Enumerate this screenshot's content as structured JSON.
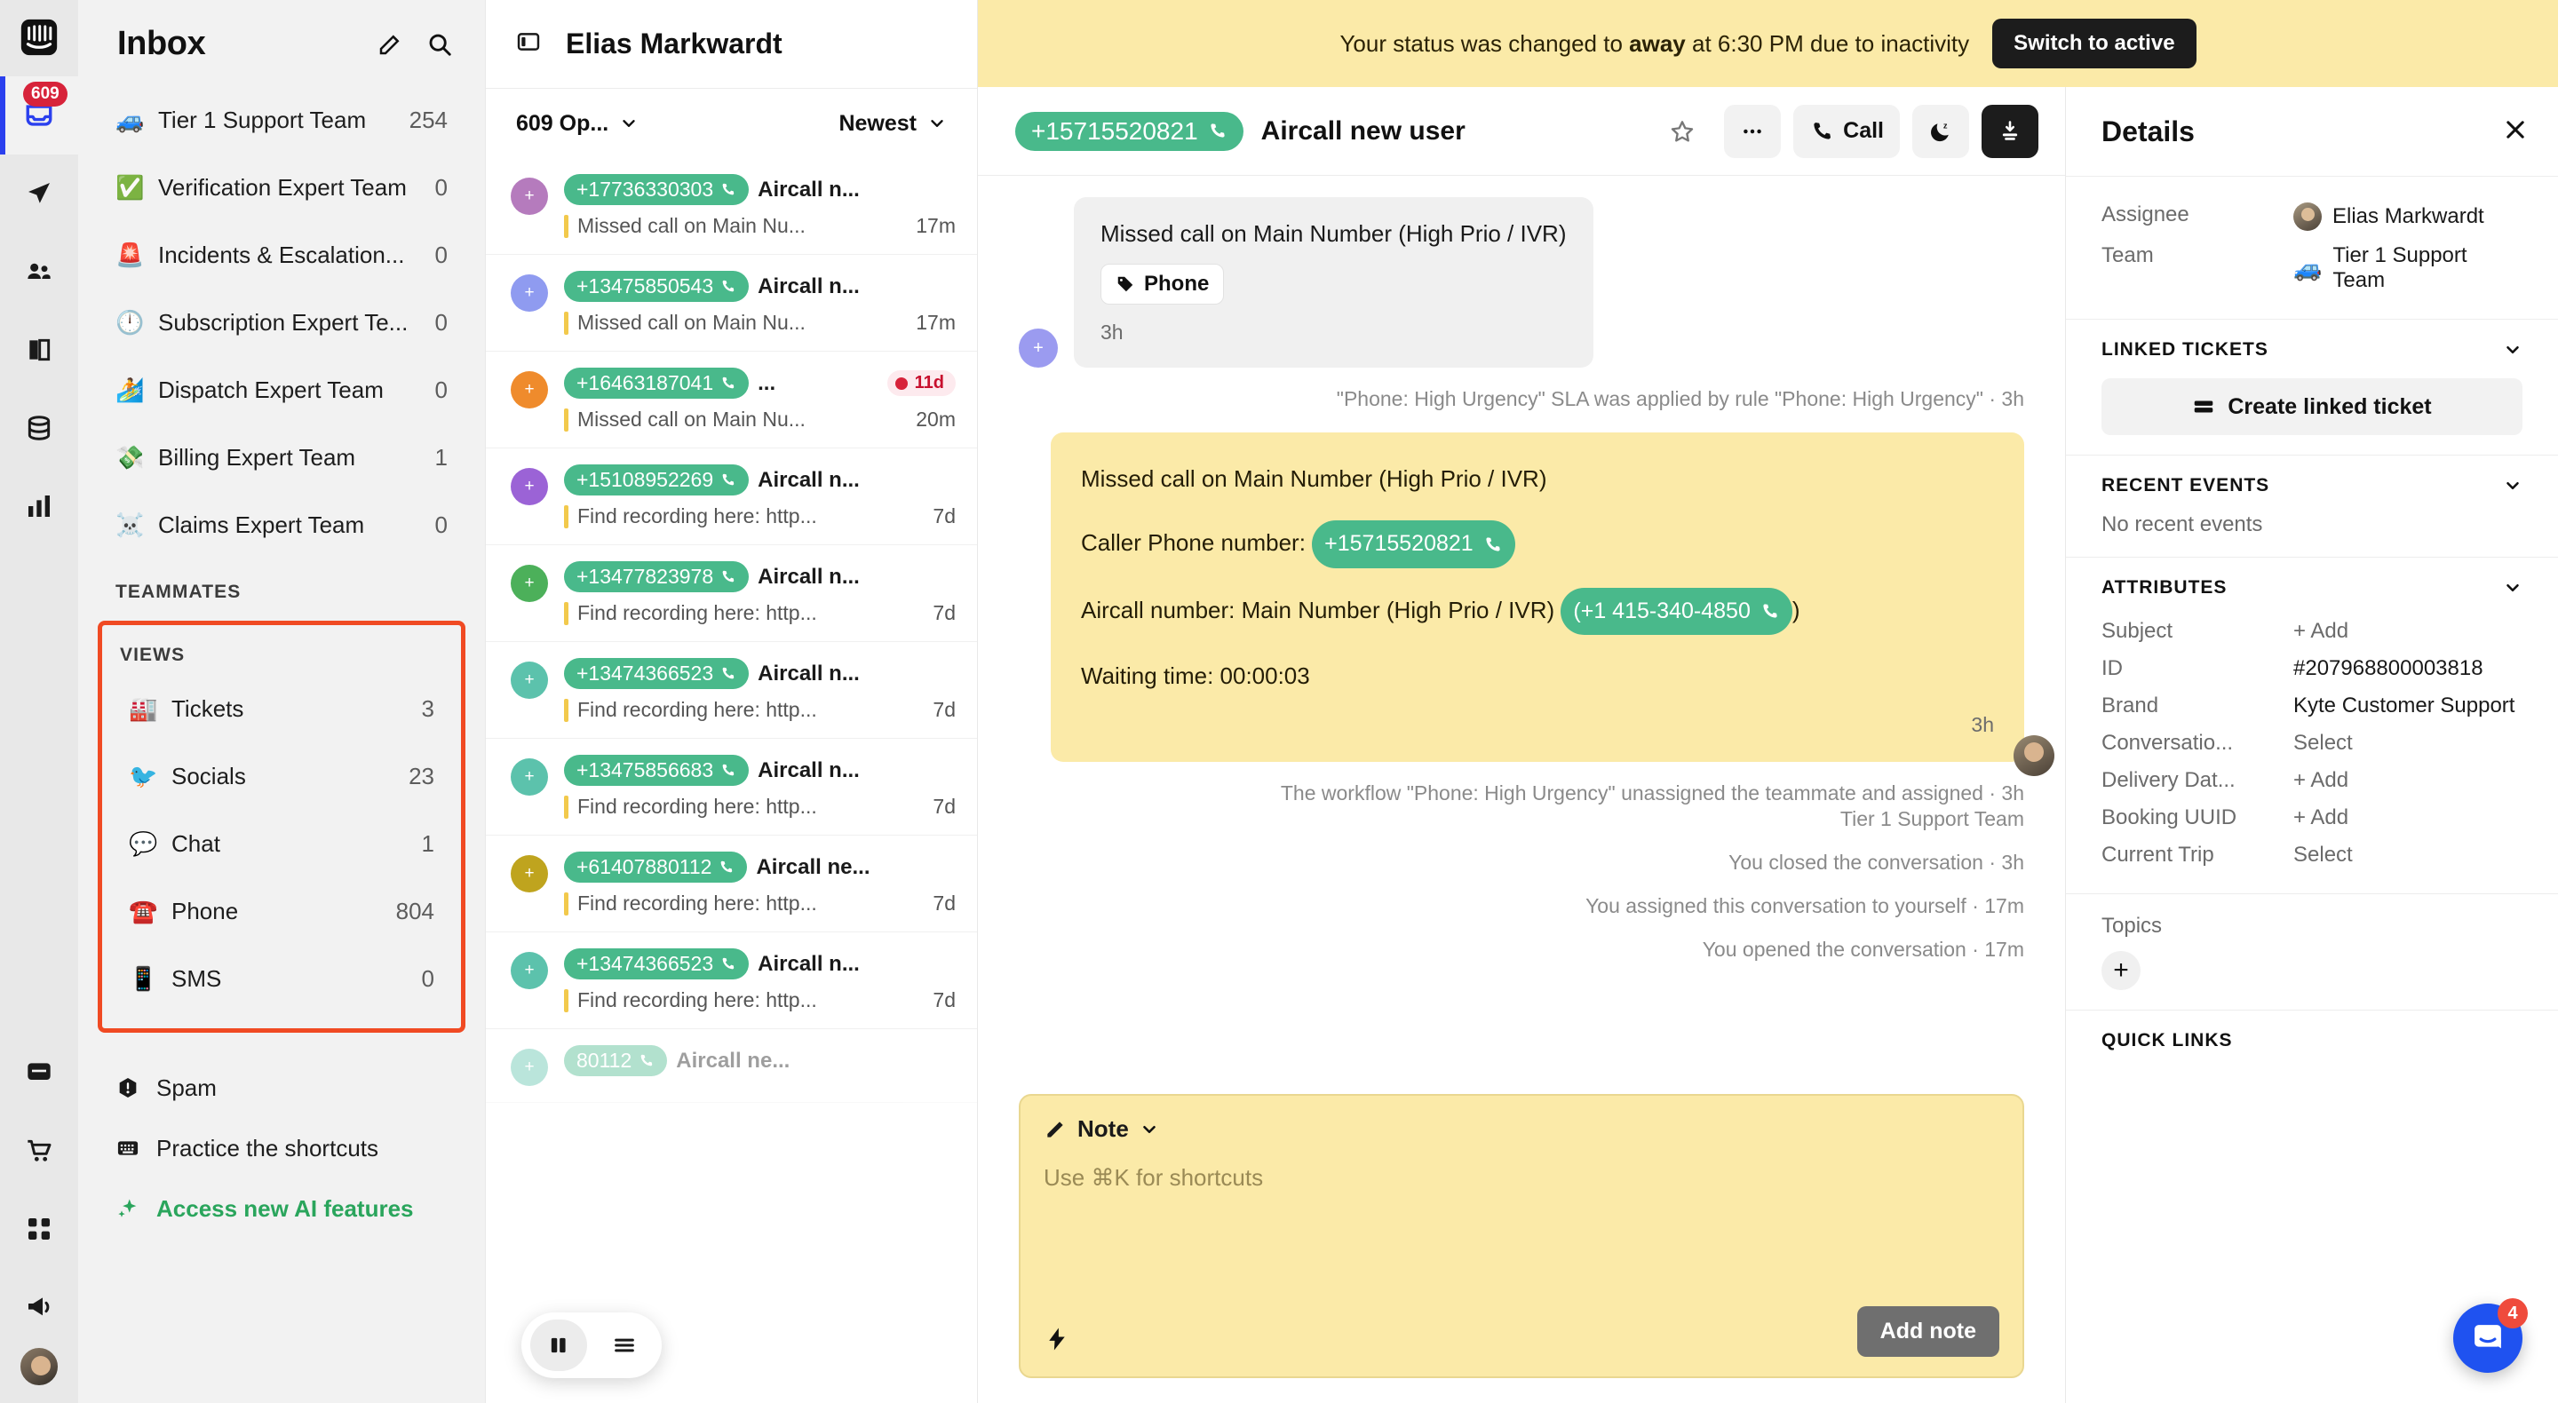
{
  "rail": {
    "logo_icon": "intercom-logo-icon",
    "inbox_badge": "609",
    "items": [
      {
        "name": "inbox-icon",
        "active": true
      },
      {
        "name": "send-icon",
        "active": false
      },
      {
        "name": "contacts-icon",
        "active": false
      },
      {
        "name": "knowledge-icon",
        "active": false
      },
      {
        "name": "database-icon",
        "active": false
      },
      {
        "name": "reports-icon",
        "active": false
      },
      {
        "name": "messages-icon",
        "active": false
      },
      {
        "name": "commerce-icon",
        "active": false
      },
      {
        "name": "apps-icon",
        "active": false
      },
      {
        "name": "megaphone-icon",
        "active": false
      }
    ]
  },
  "sidebar": {
    "title": "Inbox",
    "compose_icon": "compose-icon",
    "search_icon": "search-icon",
    "teams": [
      {
        "emoji": "🚙",
        "label": "Tier 1 Support Team",
        "count": "254"
      },
      {
        "emoji": "✅",
        "label": "Verification Expert Team",
        "count": "0"
      },
      {
        "emoji": "🚨",
        "label": "Incidents & Escalation...",
        "count": "0"
      },
      {
        "emoji": "🕛",
        "label": "Subscription Expert Te...",
        "count": "0"
      },
      {
        "emoji": "🏄",
        "label": "Dispatch Expert Team",
        "count": "0"
      },
      {
        "emoji": "💸",
        "label": "Billing Expert Team",
        "count": "1"
      },
      {
        "emoji": "☠️",
        "label": "Claims Expert Team",
        "count": "0"
      }
    ],
    "teammates_heading": "TEAMMATES",
    "views_heading": "VIEWS",
    "views": [
      {
        "emoji": "🏭",
        "label": "Tickets",
        "count": "3"
      },
      {
        "emoji": "🐦",
        "label": "Socials",
        "count": "23"
      },
      {
        "emoji": "💬",
        "label": "Chat",
        "count": "1"
      },
      {
        "emoji": "☎️",
        "label": "Phone",
        "count": "804"
      },
      {
        "emoji": "📱",
        "label": "SMS",
        "count": "0"
      }
    ],
    "bottom": [
      {
        "icon": "spam-icon",
        "label": "Spam"
      },
      {
        "icon": "keyboard-icon",
        "label": "Practice the shortcuts"
      },
      {
        "icon": "sparkles-icon",
        "label": "Access new AI features",
        "accent": true
      }
    ]
  },
  "conversation_list": {
    "panel_toggle_icon": "panel-toggle-icon",
    "owner_name": "Elias Markwardt",
    "filter_label": "609 Op...",
    "sort_label": "Newest",
    "items": [
      {
        "avatar_color": "#b57bbd",
        "avatar_text": "+",
        "phone": "+17736330303",
        "title": "Aircall n...",
        "preview": "Missed call on Main Nu...",
        "time": "17m"
      },
      {
        "avatar_color": "#8f9bf0",
        "avatar_text": "+",
        "phone": "+13475850543",
        "title": "Aircall n...",
        "preview": "Missed call on Main Nu...",
        "time": "17m"
      },
      {
        "avatar_color": "#ef8b2c",
        "avatar_text": "+",
        "phone": "+16463187041",
        "title": "...",
        "preview": "Missed call on Main Nu...",
        "time": "20m",
        "sla_badge": "11d"
      },
      {
        "avatar_color": "#9b63d6",
        "avatar_text": "+",
        "phone": "+15108952269",
        "title": "Aircall n...",
        "preview": "Find recording here: http...",
        "time": "7d"
      },
      {
        "avatar_color": "#4cb05a",
        "avatar_text": "+",
        "phone": "+13477823978",
        "title": "Aircall n...",
        "preview": "Find recording here: http...",
        "time": "7d"
      },
      {
        "avatar_color": "#5cc2ac",
        "avatar_text": "+",
        "phone": "+13474366523",
        "title": "Aircall n...",
        "preview": "Find recording here: http...",
        "time": "7d"
      },
      {
        "avatar_color": "#5cc2ac",
        "avatar_text": "+",
        "phone": "+13475856683",
        "title": "Aircall n...",
        "preview": "Find recording here: http...",
        "time": "7d"
      },
      {
        "avatar_color": "#bfa41e",
        "avatar_text": "+",
        "phone": "+61407880112",
        "title": "Aircall ne...",
        "preview": "Find recording here: http...",
        "time": "7d"
      },
      {
        "avatar_color": "#5cc2ac",
        "avatar_text": "+",
        "phone": "+13474366523",
        "title": "Aircall n...",
        "preview": "Find recording here: http...",
        "time": "7d"
      },
      {
        "avatar_color": "#5cc2ac",
        "avatar_text": "+",
        "phone": "80112",
        "title": "Aircall ne...",
        "preview": "",
        "time": "",
        "faded": true
      }
    ],
    "float_left_icon": "split-view-icon",
    "float_right_icon": "list-view-icon"
  },
  "banner": {
    "text_before": "Your status was changed to ",
    "status_word": "away",
    "text_after": " at 6:30 PM due to inactivity",
    "button_label": "Switch to active"
  },
  "thread": {
    "header": {
      "phone_pill": "+15715520821",
      "contact_name": "Aircall new user",
      "star_icon": "star-icon",
      "more_icon": "more-options-icon",
      "call_label": "Call",
      "snooze_icon": "snooze-icon",
      "close_icon": "close-conversation-icon"
    },
    "incoming": {
      "title": "Missed call on Main Number (High Prio / IVR)",
      "tag_icon": "tag-icon",
      "tag_label": "Phone",
      "time": "3h"
    },
    "sla_line": "\"Phone: High Urgency\" SLA was applied by rule \"Phone: High Urgency\" · 3h",
    "note": {
      "line1": "Missed call on Main Number (High Prio / IVR)",
      "line2_label": "Caller Phone number: ",
      "line2_pill": "+15715520821",
      "line3_label": "Aircall number: Main Number (High Prio / IVR) ",
      "line3_pill": "(+1 415-340-4850",
      "line3_after": ")",
      "line4": "Waiting time: 00:00:03",
      "time": "3h"
    },
    "events": [
      "The workflow \"Phone: High Urgency\" unassigned the teammate and assigned · 3h",
      "Tier 1 Support Team",
      "You closed the conversation · 3h",
      "You assigned this conversation to yourself · 17m",
      "You opened the conversation · 17m"
    ],
    "composer": {
      "mode_icon": "pencil-icon",
      "mode_label": "Note",
      "placeholder": "Use ⌘K for shortcuts",
      "lightning_icon": "lightning-icon",
      "submit_label": "Add note"
    }
  },
  "details": {
    "title": "Details",
    "close_icon": "close-icon",
    "assignee_label": "Assignee",
    "assignee_value": "Elias Markwardt",
    "team_label": "Team",
    "team_emoji": "🚙",
    "team_value": "Tier 1 Support Team",
    "linked_tickets_heading": "LINKED TICKETS",
    "create_linked_ticket_label": "Create linked ticket",
    "create_linked_ticket_icon": "ticket-icon",
    "recent_events_heading": "RECENT EVENTS",
    "recent_events_empty": "No recent events",
    "attributes_heading": "ATTRIBUTES",
    "attributes": [
      {
        "key": "Subject",
        "value": "+ Add",
        "muted": true
      },
      {
        "key": "ID",
        "value": "#207968800003818",
        "muted": false
      },
      {
        "key": "Brand",
        "value": "Kyte Customer Support",
        "muted": false
      },
      {
        "key": "Conversatio...",
        "value": "Select",
        "muted": true
      },
      {
        "key": "Delivery Dat...",
        "value": "+ Add",
        "muted": true
      },
      {
        "key": "Booking UUID",
        "value": "+ Add",
        "muted": true
      },
      {
        "key": "Current Trip",
        "value": "Select",
        "muted": true
      }
    ],
    "topics_label": "Topics",
    "topics_add_icon": "plus-icon",
    "quick_links_heading": "QUICK LINKS",
    "intercom_badge": "4",
    "intercom_icon": "intercom-messenger-icon"
  }
}
